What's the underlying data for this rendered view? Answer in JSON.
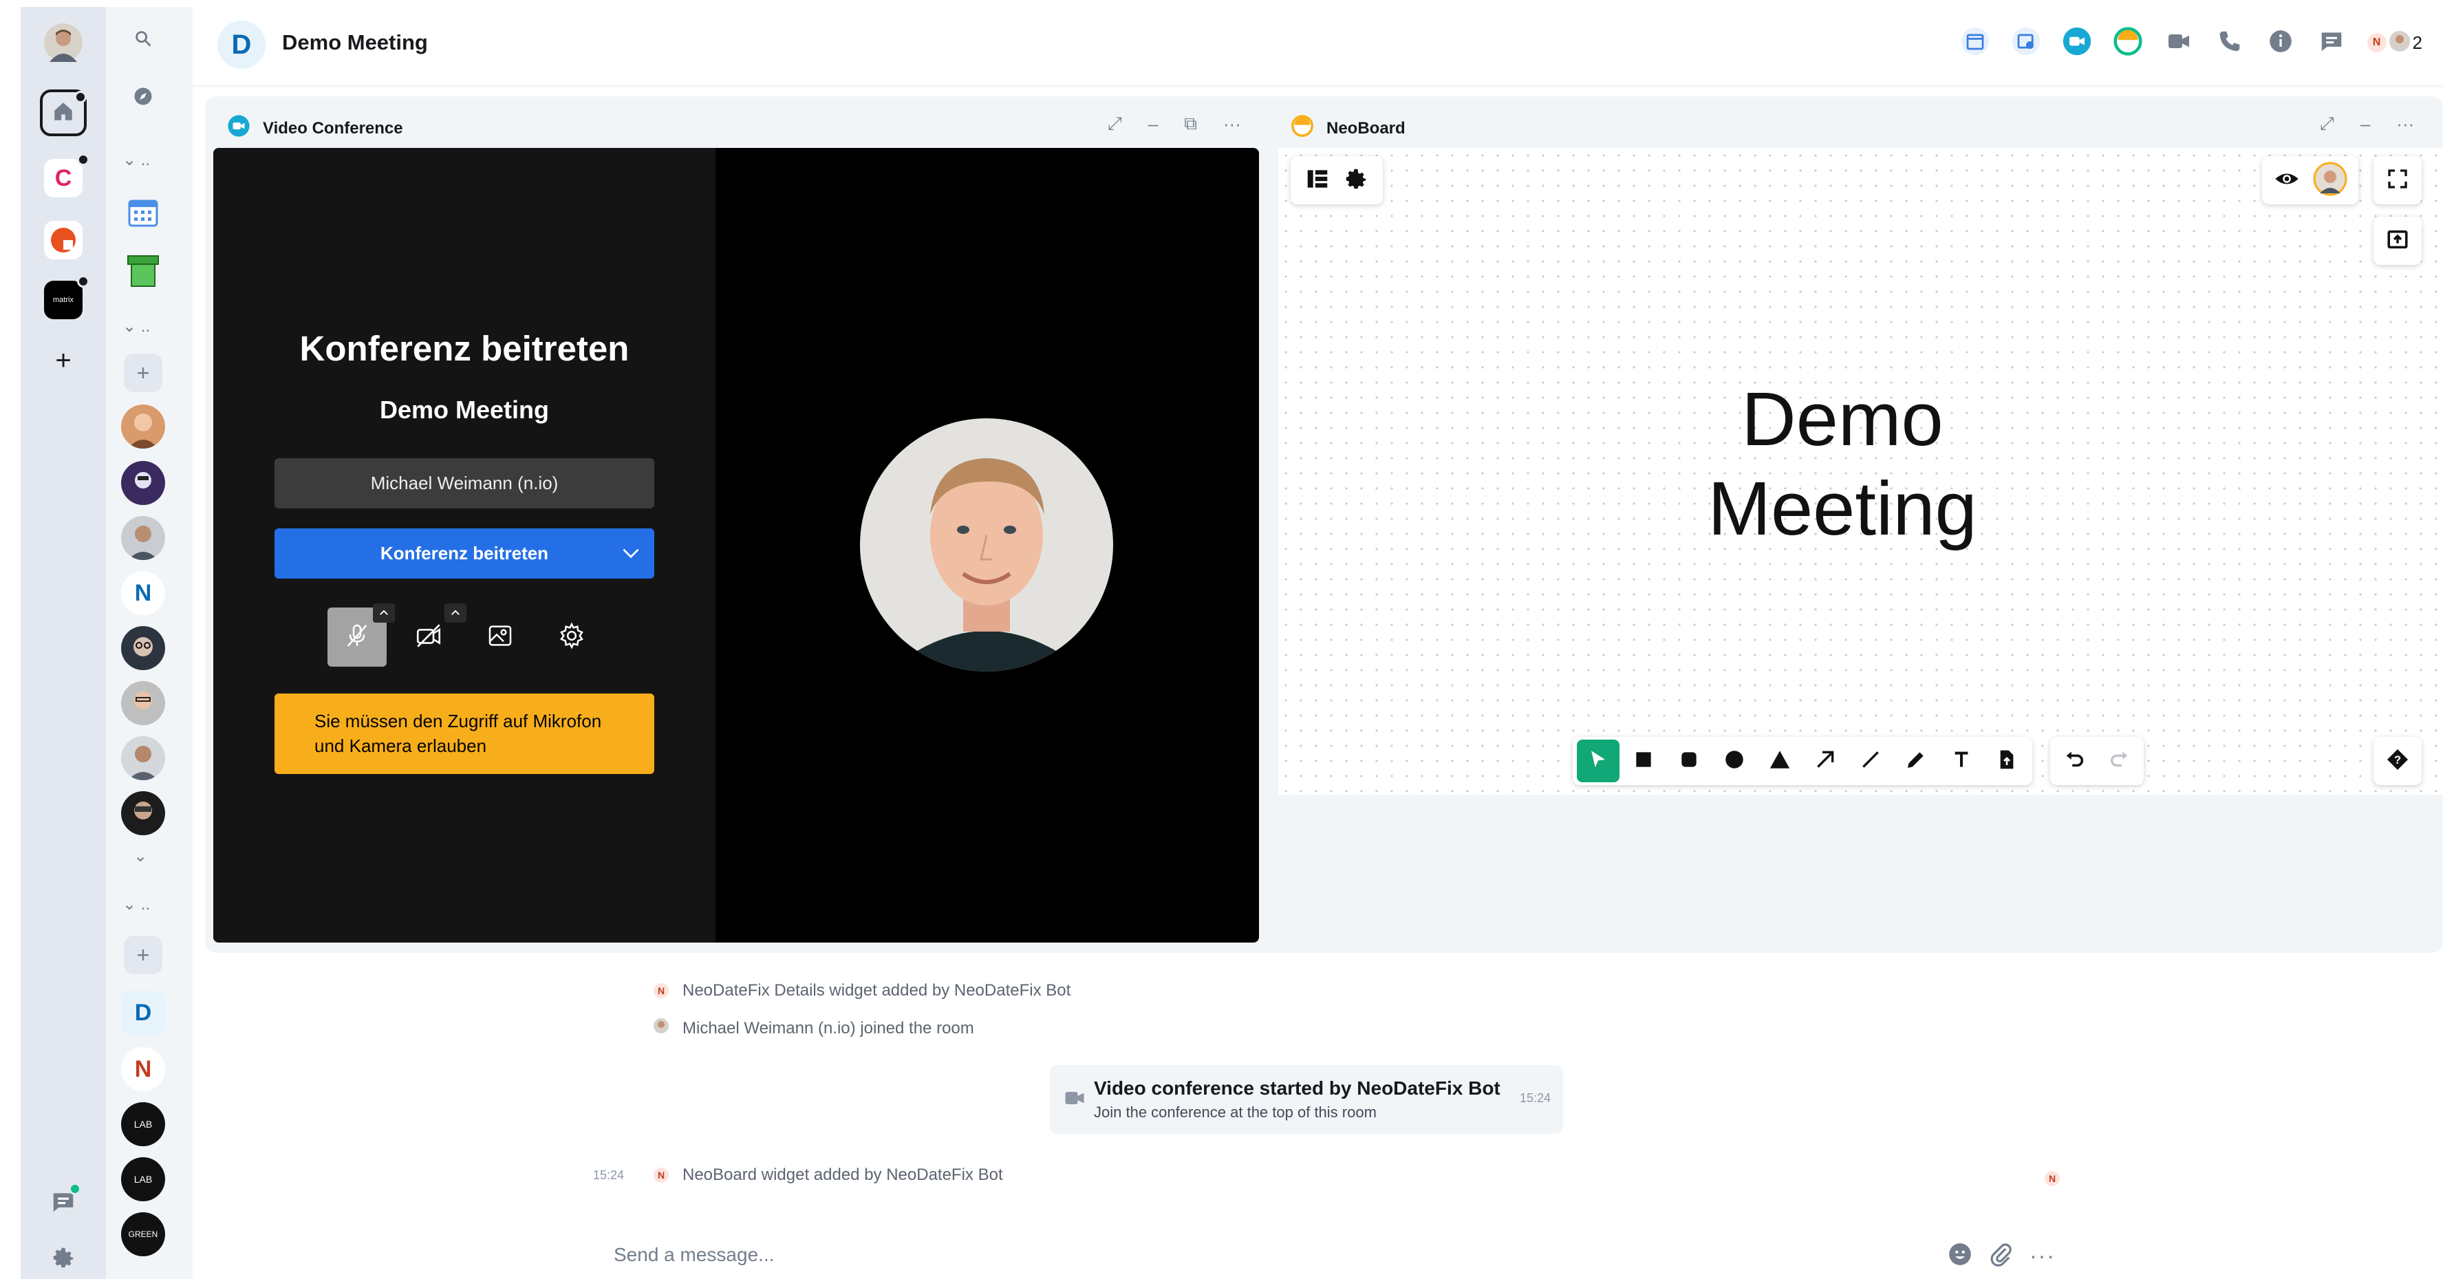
{
  "room": {
    "avatar_letter": "D",
    "title": "Demo Meeting",
    "member_count": "2",
    "member_badge_letter": "N"
  },
  "rail": {
    "space_letter_c": "C",
    "matrix_label": "matrix",
    "add_label": "+"
  },
  "roomlist": {
    "section_label": "..",
    "room_letter_n": "N",
    "room_letter_d": "D",
    "room_letter_n2": "N",
    "lab_labels": [
      "LAB",
      "LAB",
      "GREEN"
    ]
  },
  "video_widget": {
    "title": "Video Conference",
    "heading": "Konferenz beitreten",
    "meeting_name": "Demo Meeting",
    "display_name": "Michael Weimann (n.io)",
    "join_button": "Konferenz beitreten",
    "warning": "Sie müssen den Zugriff auf Mikrofon und Kamera erlauben"
  },
  "neoboard": {
    "title": "NeoBoard",
    "slide_text_line1": "Demo",
    "slide_text_line2": "Meeting"
  },
  "timeline": {
    "event1": "NeoDateFix Details widget added by NeoDateFix Bot",
    "event2": "Michael Weimann (n.io) joined the room",
    "call_title": "Video conference started by NeoDateFix Bot",
    "call_subtitle": "Join the conference at the top of this room",
    "call_time": "15:24",
    "event3_time": "15:24",
    "event3": "NeoBoard widget added by NeoDateFix Bot",
    "badge_letter": "N"
  },
  "composer": {
    "placeholder": "Send a message..."
  },
  "colors": {
    "accent_green": "#0dbd8b",
    "join_blue": "#246fe5",
    "warning_amber": "#f8ae1a",
    "neoboard_active": "#12a776"
  }
}
